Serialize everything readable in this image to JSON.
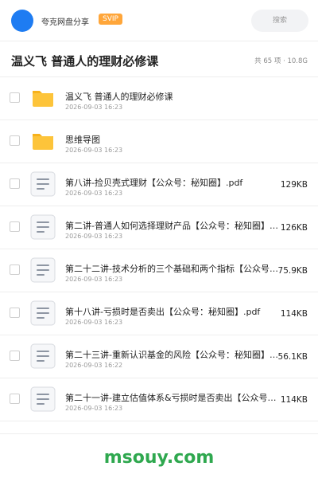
{
  "app": {
    "name": "夸克网盘分享",
    "badge": "SVIP",
    "search_placeholder": "搜索"
  },
  "folder": {
    "title": "温义飞 普通人的理财必修课",
    "meta": "共 65 项 · 10.8G"
  },
  "colors": {
    "avatar": "#1e7cf2",
    "svip": "#ffa63a",
    "folder": "#fdc43a",
    "watermark": "#2fa84f"
  },
  "items": [
    {
      "type": "folder",
      "icon": "folder-icon",
      "name": "温义飞 普通人的理财必修课",
      "date": "2026-09-03 16:23",
      "size": ""
    },
    {
      "type": "folder",
      "icon": "folder-icon",
      "name": "思维导图",
      "date": "2026-09-03 16:23",
      "size": ""
    },
    {
      "type": "file",
      "icon": "document-icon",
      "name": "第八讲-捡贝壳式理财【公众号：秘知圈】.pdf",
      "date": "2026-09-03 16:23",
      "size": "129KB"
    },
    {
      "type": "file",
      "icon": "document-icon",
      "name": "第二讲-普通人如何选择理财产品【公众号：秘知圈】.pdf",
      "date": "2026-09-03 16:23",
      "size": "126KB"
    },
    {
      "type": "file",
      "icon": "document-icon",
      "name": "第二十二讲-技术分析的三个基础和两个指标【公众号：秘知圈】.pdf",
      "date": "2026-09-03 16:23",
      "size": "75.9KB"
    },
    {
      "type": "file",
      "icon": "document-icon",
      "name": "第十八讲-亏损时是否卖出【公众号：秘知圈】.pdf",
      "date": "2026-09-03 16:23",
      "size": "114KB"
    },
    {
      "type": "file",
      "icon": "document-icon",
      "name": "第二十三讲-重新认识基金的风险【公众号：秘知圈】.pdf",
      "date": "2026-09-03 16:22",
      "size": "56.1KB"
    },
    {
      "type": "file",
      "icon": "document-icon",
      "name": "第二十一讲-建立估值体系&亏损时是否卖出【公众号：秘知圈】.pdf",
      "date": "2026-09-03 16:23",
      "size": "114KB"
    }
  ],
  "watermark": "msouy.com"
}
